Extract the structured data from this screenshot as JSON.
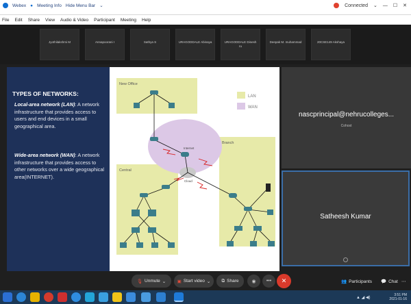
{
  "window": {
    "app_title": "Webex",
    "meeting_info": "Meeting Info",
    "hide_menu": "Hide Menu Bar",
    "connected": "Connected"
  },
  "menu": [
    "File",
    "Edit",
    "Share",
    "View",
    "Audio & Video",
    "Participant",
    "Meeting",
    "Help"
  ],
  "participants_strip": [
    "Jyothilakshmi M",
    "Annapoorani I",
    "Sathya S",
    "URAGODDALE Abinaya",
    "URAGODDALE Dinesh ru",
    "Deepak M. muhammad",
    "20CSE149 Akshaya"
  ],
  "slide": {
    "heading": "TYPES OF NETWORKS:",
    "lan_term": "Local-area network (LAN)",
    "lan_text": ": A network infrastructure that provides access to users and end devices in a small geographical area.",
    "wan_term": "Wide-area network (WAN)",
    "wan_text": ": A network infrastructure that provides access to other networks over a wide geographical area(INTERNET)."
  },
  "diagram": {
    "new_office": "New Office",
    "branch": "Branch",
    "central": "Central",
    "internet": "Internet",
    "cloud": "Cloud",
    "legend_lan": "LAN",
    "legend_wan": "WAN",
    "lan_color": "#e7eaa9",
    "wan_color": "#dcc8e6"
  },
  "tiles": {
    "presenter_email": "nascprincipal@nehrucolleges...",
    "presenter_role": "Cohost",
    "self_name": "Satheesh Kumar"
  },
  "controls": {
    "unmute": "Unmute",
    "start_video": "Start video",
    "share": "Share",
    "participants": "Participants",
    "chat": "Chat"
  },
  "tray": {
    "time": "3:51 PM",
    "date": "2021-01-16"
  }
}
